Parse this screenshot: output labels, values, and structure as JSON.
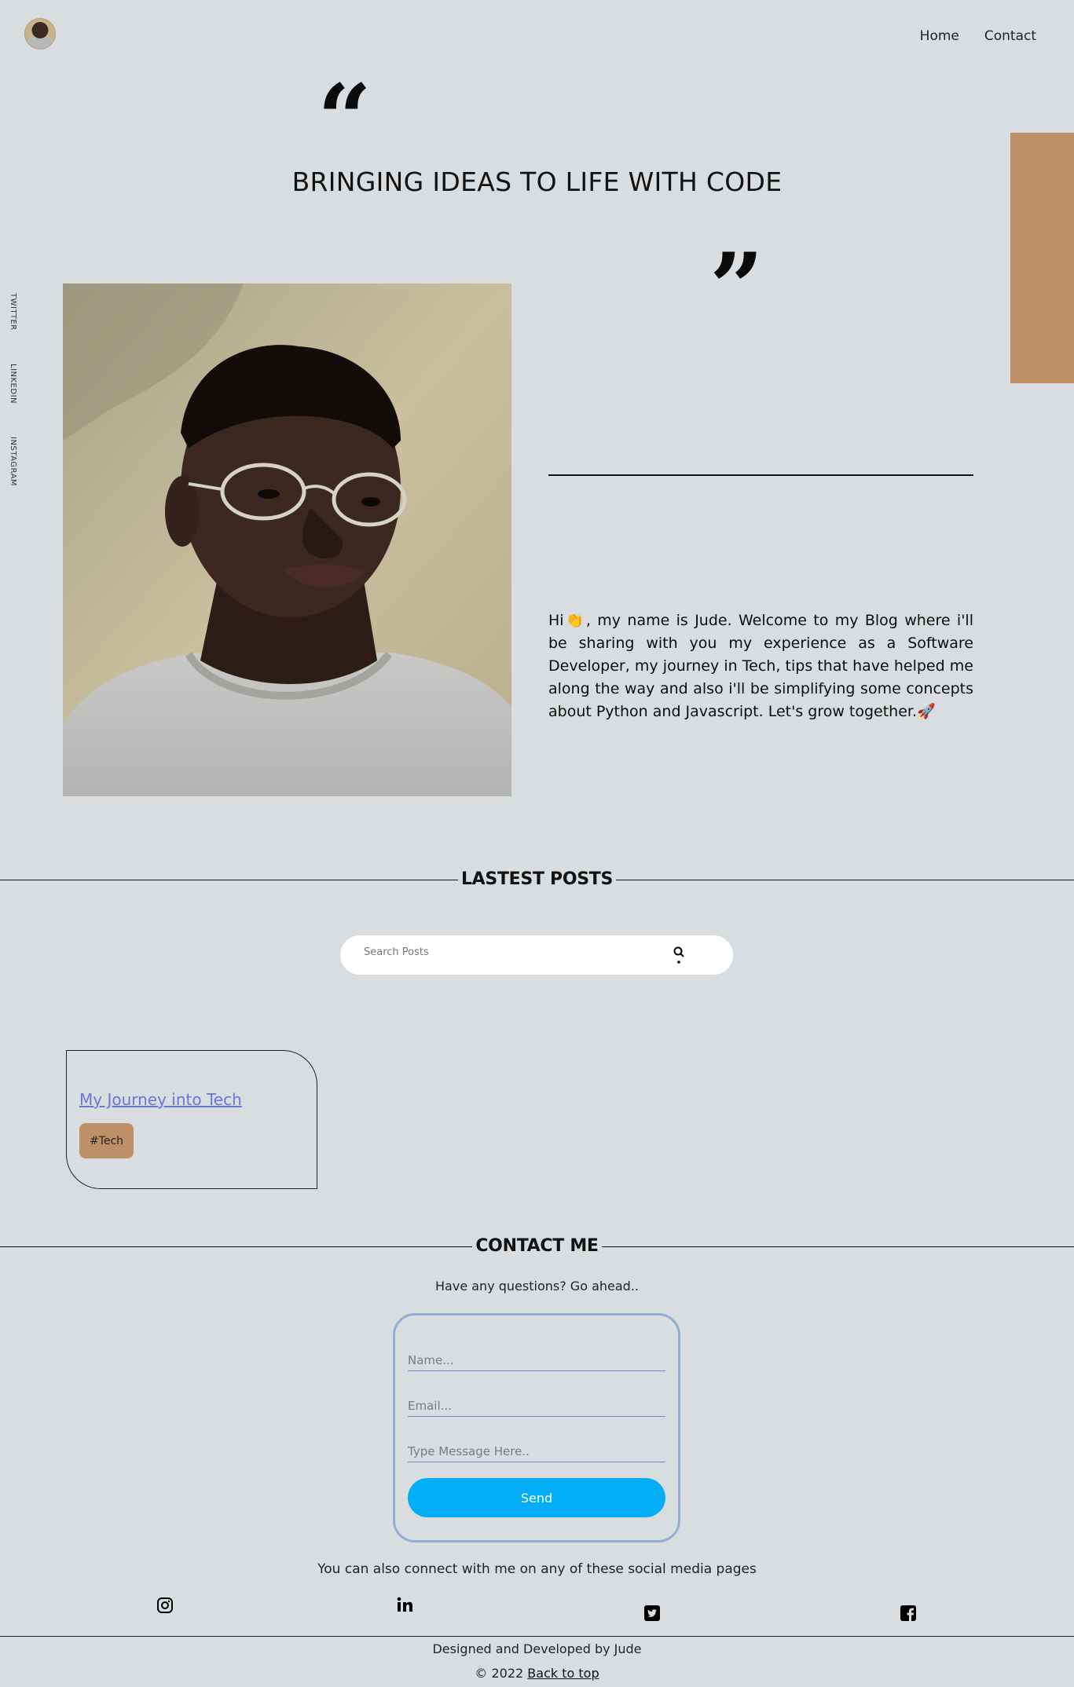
{
  "header": {
    "nav": {
      "home": "Home",
      "contact": "Contact"
    }
  },
  "hero": {
    "open_quote": "“",
    "close_quote": "”",
    "title": "BRINGING IDEAS TO LIFE WITH CODE"
  },
  "side_links": {
    "twitter": "TWITTER",
    "linkedin": "LINKEDIN",
    "instagram": "INSTAGRAM"
  },
  "intro": {
    "text": "Hi👏, my name is Jude. Welcome to my Blog where i'll be sharing with you my experience as a Software Developer, my journey in Tech, tips that have helped me along the way and also i'll be simplifying some concepts about Python and Javascript. Let's grow together.🚀"
  },
  "posts": {
    "heading": "LASTEST POSTS",
    "search_placeholder": "Search Posts",
    "items": [
      {
        "title": "My Journey into Tech",
        "tag": "#Tech"
      }
    ]
  },
  "contact": {
    "heading": "CONTACT ME",
    "subtitle": "Have any questions? Go ahead..",
    "name_placeholder": "Name...",
    "email_placeholder": "Email...",
    "message_placeholder": "Type Message Here..",
    "send_label": "Send",
    "connect_text": "You can also connect with me on any of these social media pages"
  },
  "footer": {
    "credit": "Designed and Developed by Jude",
    "copyright": "© 2022",
    "back_to_top": "Back to top"
  },
  "colors": {
    "background": "#dadddf",
    "accent": "#bd9067",
    "link": "#6a76d8",
    "button": "#04aef7",
    "form_border": "#93acd6"
  },
  "icons": [
    "instagram-icon",
    "linkedin-icon",
    "twitter-icon",
    "facebook-icon",
    "search-icon"
  ]
}
